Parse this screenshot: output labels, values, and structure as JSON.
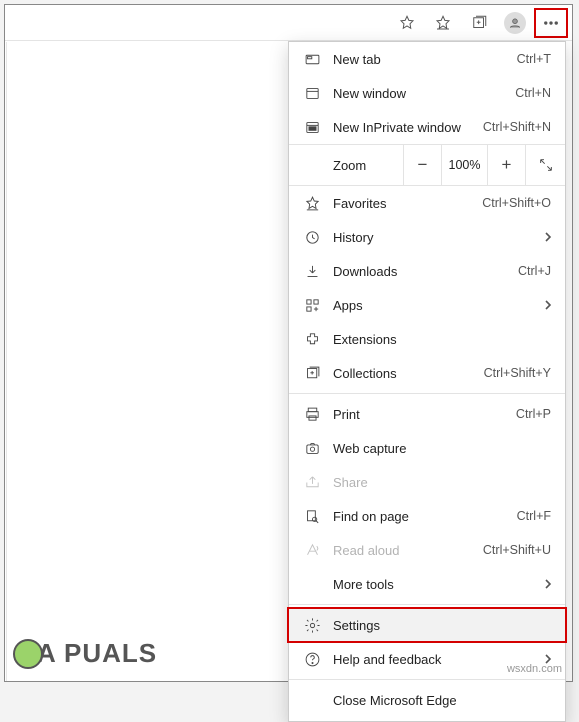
{
  "toolbar": {
    "icons": [
      "favorite-star",
      "favorites-list",
      "collections",
      "profile",
      "more"
    ]
  },
  "menu": {
    "new_tab": {
      "label": "New tab",
      "shortcut": "Ctrl+T"
    },
    "new_window": {
      "label": "New window",
      "shortcut": "Ctrl+N"
    },
    "new_inprivate": {
      "label": "New InPrivate window",
      "shortcut": "Ctrl+Shift+N"
    },
    "zoom": {
      "label": "Zoom",
      "value": "100%"
    },
    "favorites": {
      "label": "Favorites",
      "shortcut": "Ctrl+Shift+O"
    },
    "history": {
      "label": "History"
    },
    "downloads": {
      "label": "Downloads",
      "shortcut": "Ctrl+J"
    },
    "apps": {
      "label": "Apps"
    },
    "extensions": {
      "label": "Extensions"
    },
    "collections": {
      "label": "Collections",
      "shortcut": "Ctrl+Shift+Y"
    },
    "print": {
      "label": "Print",
      "shortcut": "Ctrl+P"
    },
    "web_capture": {
      "label": "Web capture"
    },
    "share": {
      "label": "Share"
    },
    "find": {
      "label": "Find on page",
      "shortcut": "Ctrl+F"
    },
    "read_aloud": {
      "label": "Read aloud",
      "shortcut": "Ctrl+Shift+U"
    },
    "more_tools": {
      "label": "More tools"
    },
    "settings": {
      "label": "Settings"
    },
    "help": {
      "label": "Help and feedback"
    },
    "close": {
      "label": "Close Microsoft Edge"
    }
  },
  "watermark": {
    "text": "A  PUALS"
  },
  "domain_watermark": "wsxdn.com"
}
